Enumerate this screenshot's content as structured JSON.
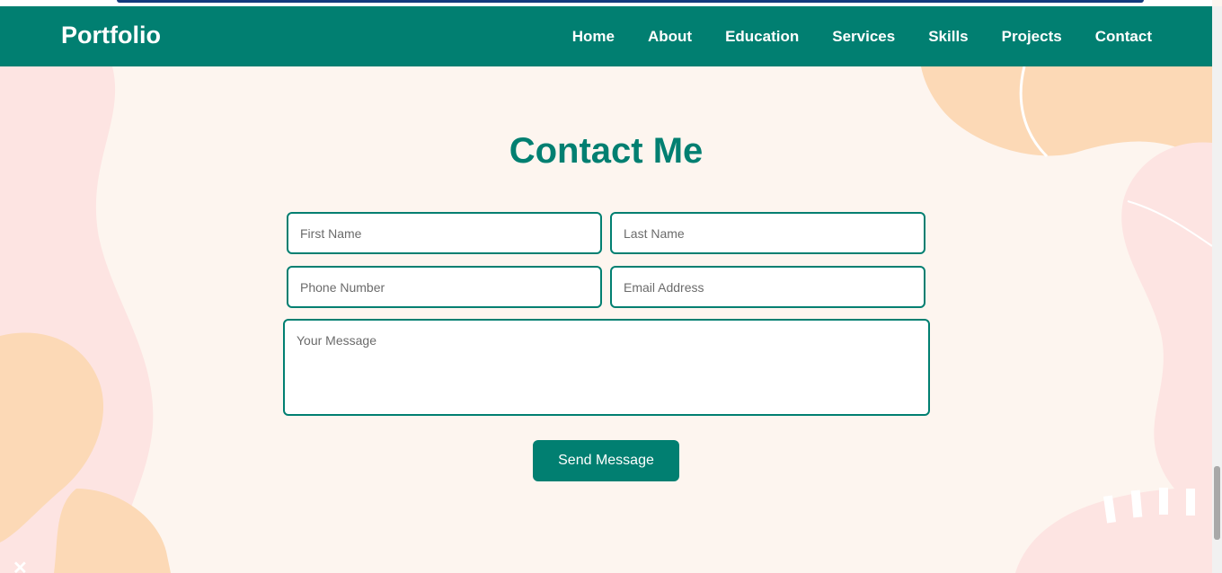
{
  "brand": "Portfolio",
  "nav": [
    "Home",
    "About",
    "Education",
    "Services",
    "Skills",
    "Projects",
    "Contact"
  ],
  "contact": {
    "title": "Contact Me",
    "first_name_placeholder": "First Name",
    "last_name_placeholder": "Last Name",
    "phone_placeholder": "Phone Number",
    "email_placeholder": "Email Address",
    "message_placeholder": "Your Message",
    "send_label": "Send Message"
  },
  "colors": {
    "accent": "#017f71",
    "page_bg": "#fdf5ef",
    "blob_peach": "#fcd9b6",
    "blob_pink": "#fde4e2"
  }
}
